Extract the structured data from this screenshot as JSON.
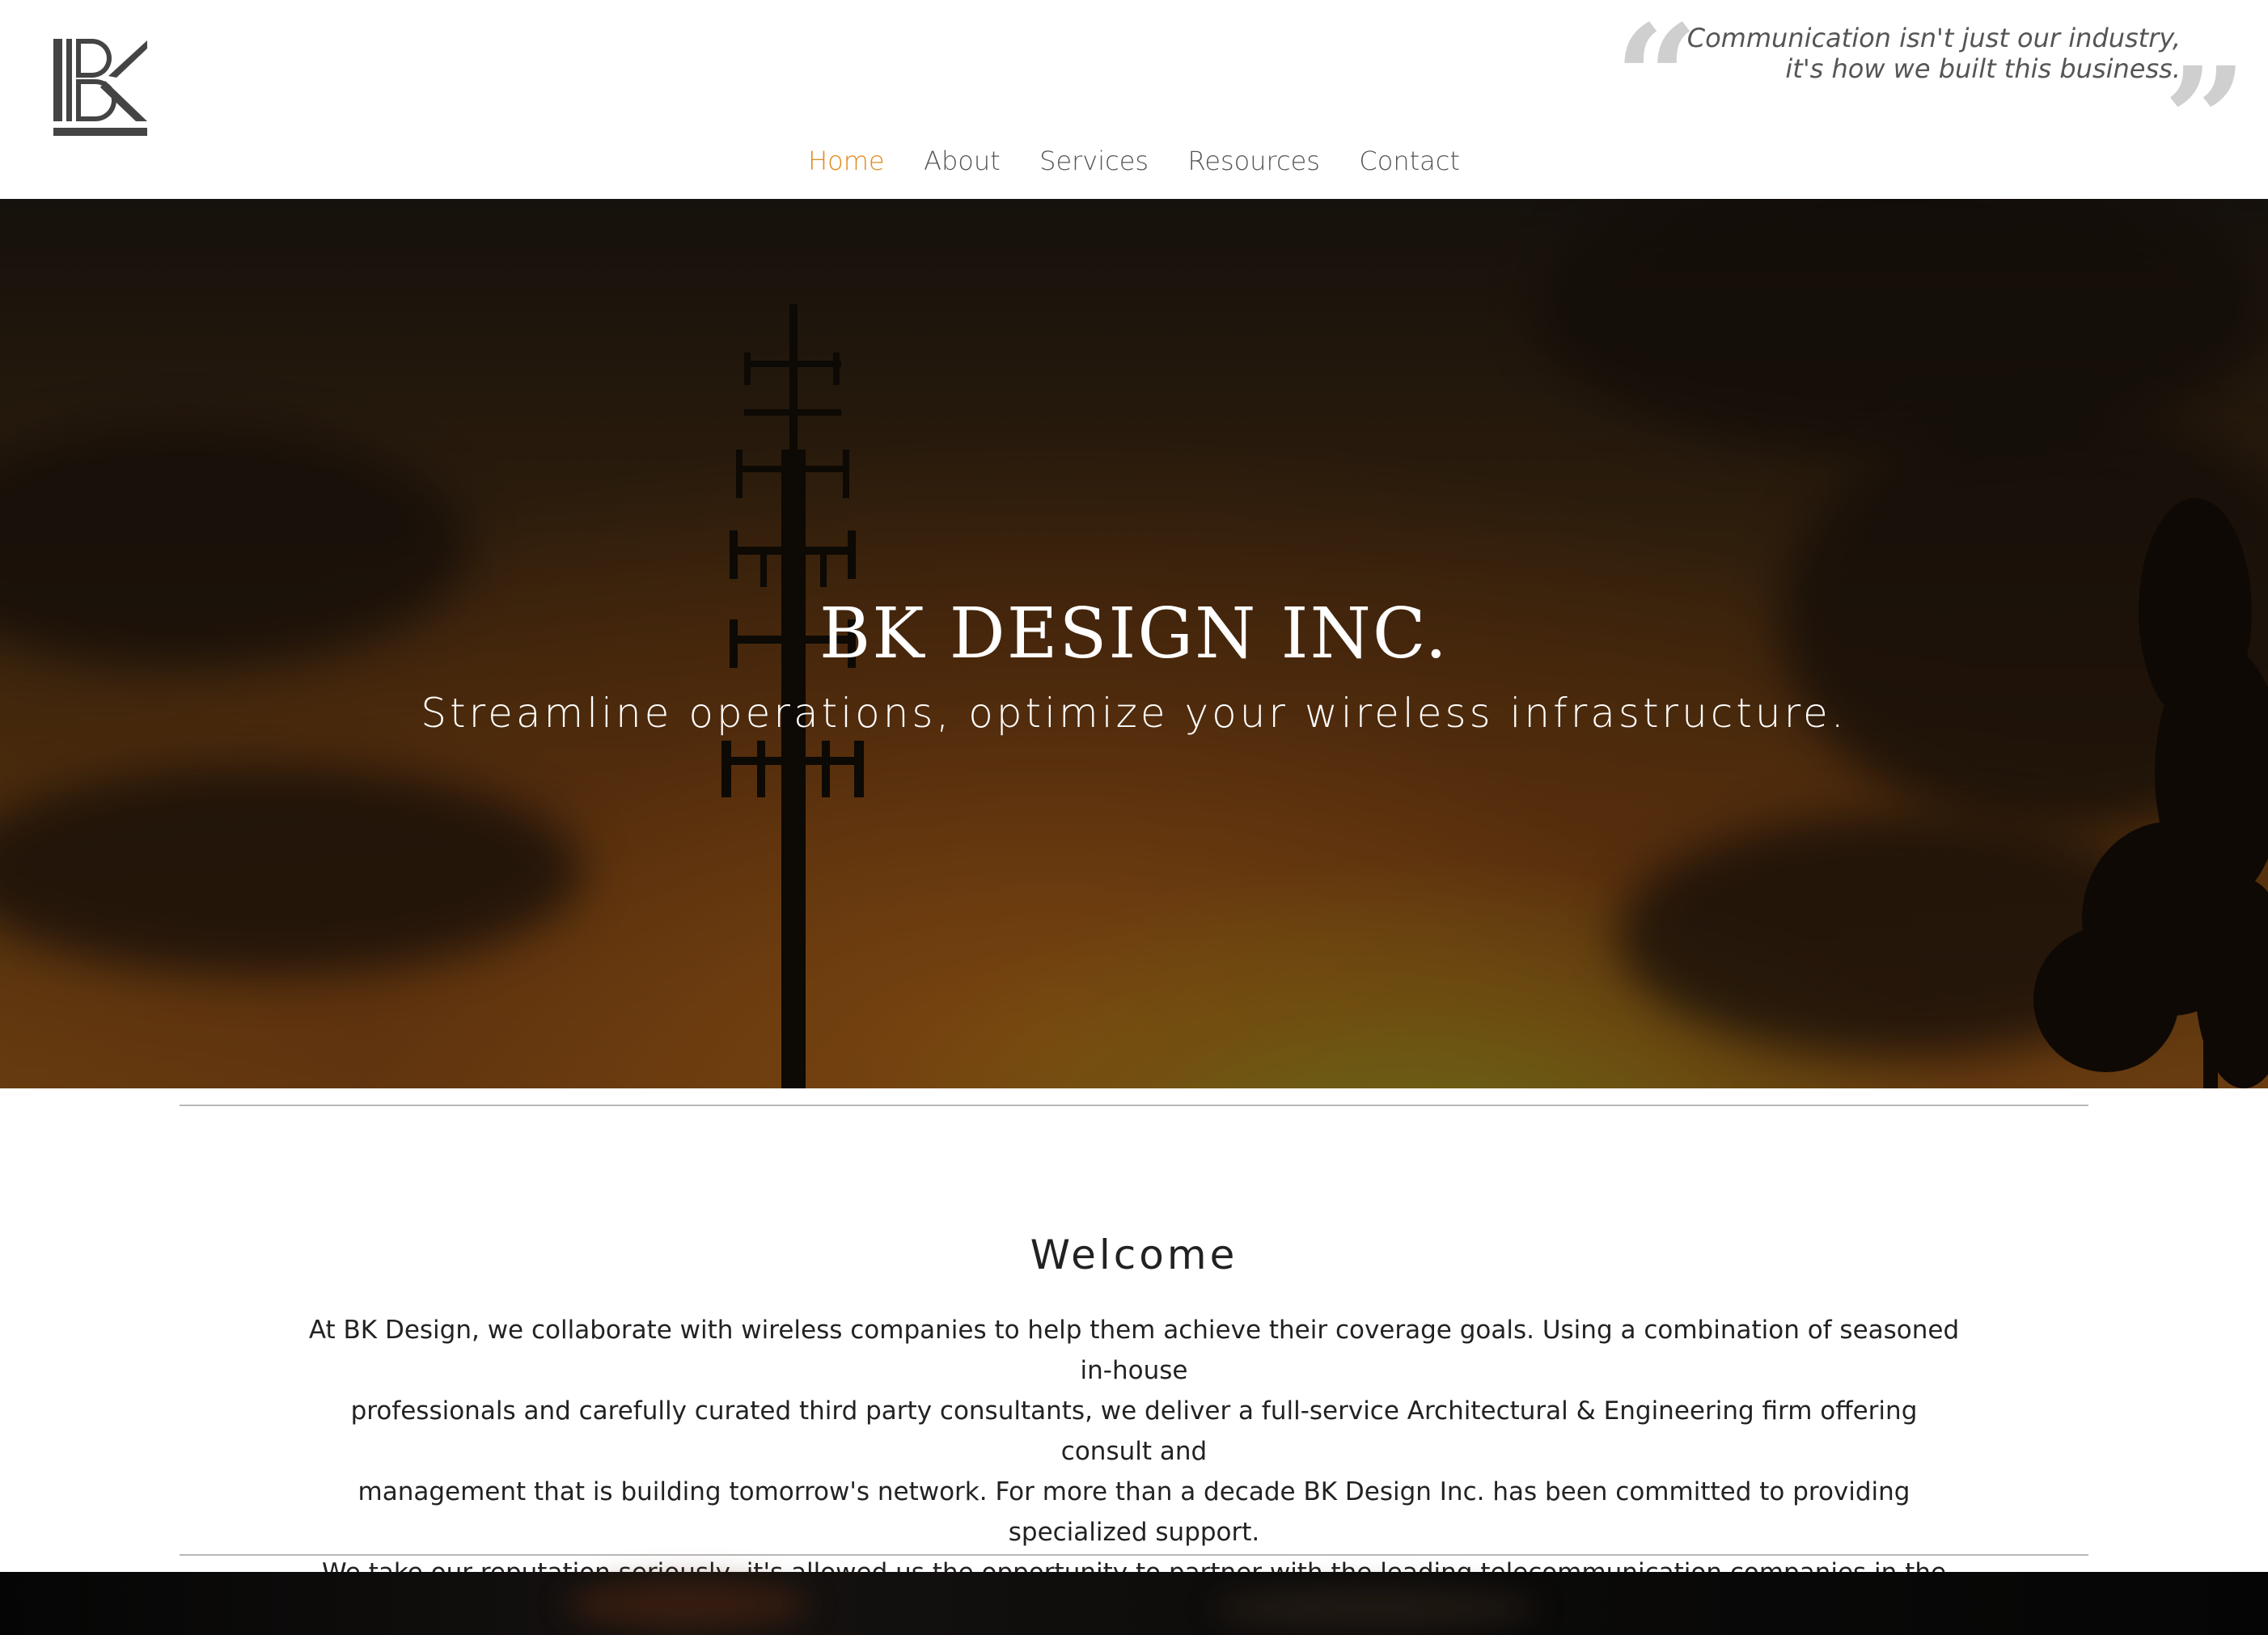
{
  "header": {
    "logo_icon": "bk-monogram-logo",
    "tagline_line1": "Communication isn't just our industry,",
    "tagline_line2": "it's how we built this business."
  },
  "nav": {
    "items": [
      {
        "label": "Home",
        "active": true
      },
      {
        "label": "About",
        "active": false
      },
      {
        "label": "Services",
        "active": false
      },
      {
        "label": "Resources",
        "active": false
      },
      {
        "label": "Contact",
        "active": false
      }
    ]
  },
  "hero": {
    "title": "BK DESIGN INC.",
    "subtitle": "Streamline operations, optimize your wireless infrastructure."
  },
  "welcome": {
    "title": "Welcome",
    "lines": [
      "At BK Design, we collaborate with wireless companies to help them achieve their coverage goals. Using a combination of seasoned in-house",
      "professionals and carefully curated third party consultants, we deliver a full-service Architectural & Engineering firm offering consult and",
      "management that is building tomorrow's network. For more than a decade BK Design Inc. has been committed to providing specialized support.",
      "We take our reputation seriously, it's allowed us the opportunity to partner with the leading telecommunication companies in the United States."
    ]
  },
  "colors": {
    "accent": "#e08a1a",
    "nav_text": "#555555",
    "body_text": "#222222",
    "rule": "#b8b8b8"
  }
}
